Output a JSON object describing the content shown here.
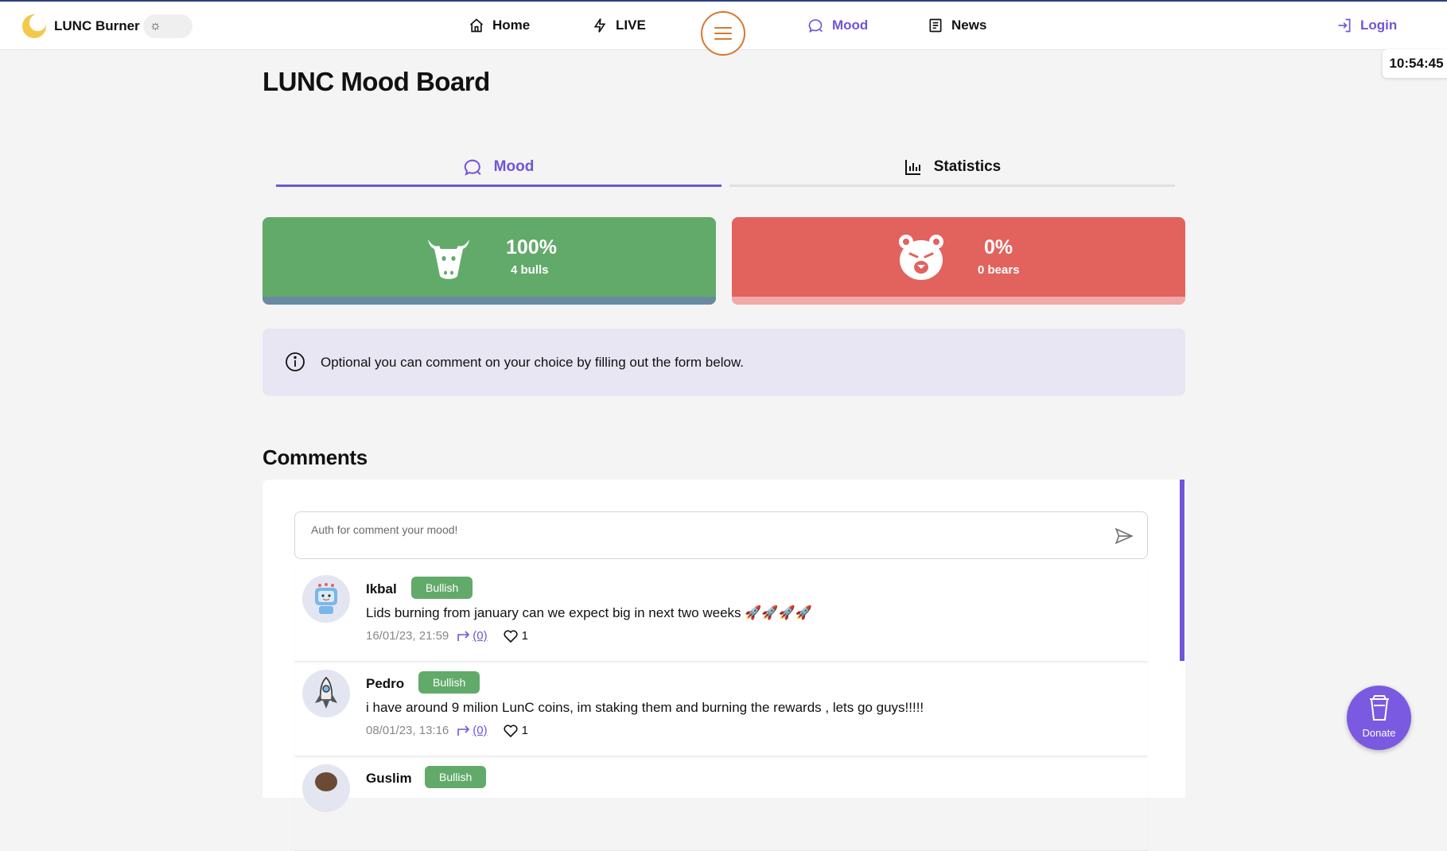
{
  "header": {
    "brand": "LUNC Burner",
    "nav": {
      "home": "Home",
      "live": "LIVE",
      "mood": "Mood",
      "news": "News"
    },
    "login": "Login"
  },
  "clock": "10:54:45",
  "page": {
    "title": "LUNC Mood Board"
  },
  "tabs": {
    "mood": "Mood",
    "statistics": "Statistics",
    "active": "Mood"
  },
  "mood": {
    "bull": {
      "percent": "100%",
      "count_label": "4 bulls"
    },
    "bear": {
      "percent": "0%",
      "count_label": "0 bears"
    }
  },
  "info": {
    "text": "Optional you can comment on your choice by filling out the form below."
  },
  "comments": {
    "title": "Comments",
    "input_placeholder": "Auth for comment your mood!",
    "items": [
      {
        "name": "Ikbal",
        "badge": "Bullish",
        "text": "Lids burning from january can we expect big in next two weeks 🚀🚀🚀🚀",
        "date": "16/01/23, 21:59",
        "shares": "(0)",
        "likes": "1",
        "avatar": "robot-avatar"
      },
      {
        "name": "Pedro",
        "badge": "Bullish",
        "text": "i have around 9 milion LunC coins, im staking them and burning the rewards , lets go guys!!!!!",
        "date": "08/01/23, 13:16",
        "shares": "(0)",
        "likes": "1",
        "avatar": "rocket-avatar"
      },
      {
        "name": "Guslim",
        "badge": "Bullish",
        "avatar": "person-avatar"
      }
    ]
  },
  "donate": {
    "label": "Donate"
  },
  "colors": {
    "accent": "#6f55d8",
    "bull": "#62aa6a",
    "bear": "#e2625d",
    "menu": "#d9772f",
    "info_bg": "#e8e6f3"
  }
}
